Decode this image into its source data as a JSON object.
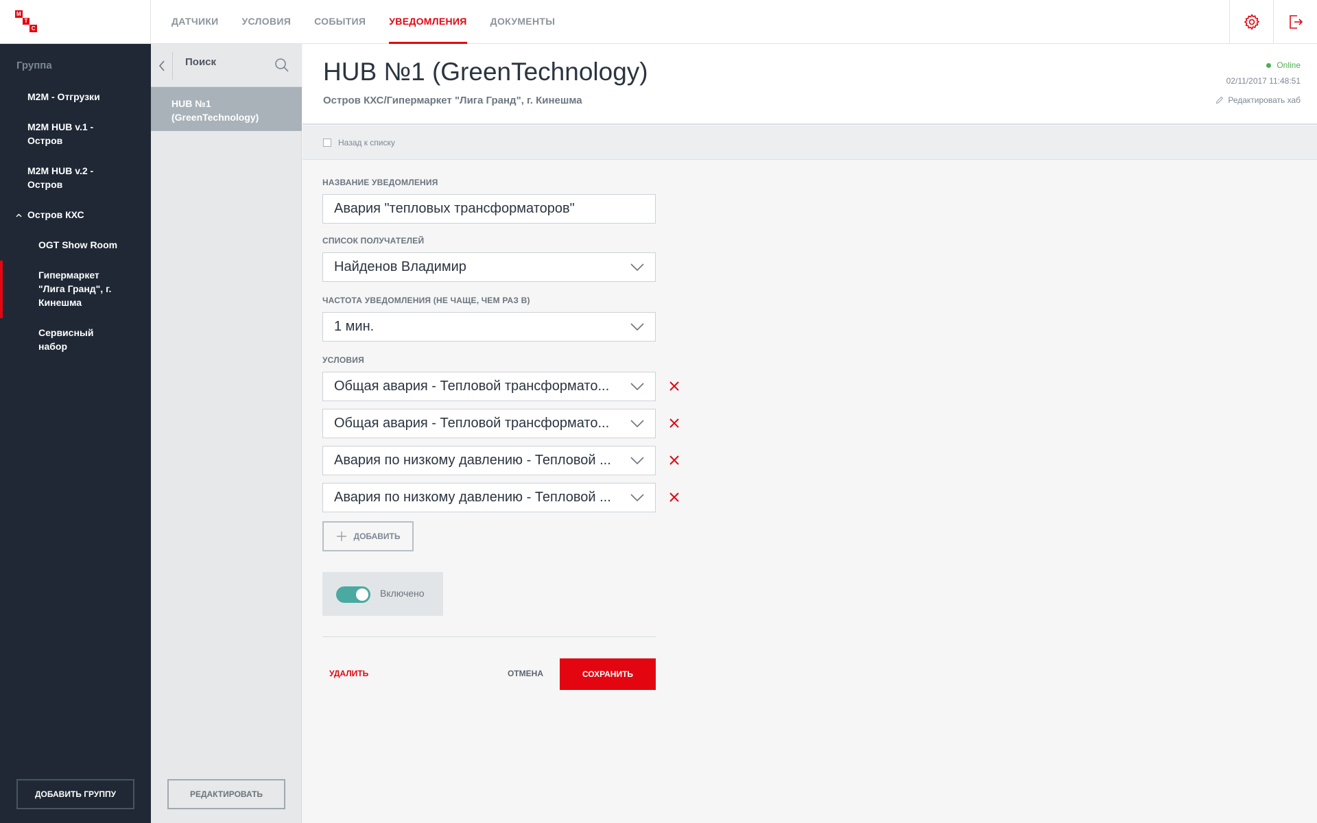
{
  "logo": {
    "letters": [
      "М",
      "Т",
      "С"
    ]
  },
  "nav": {
    "items": [
      "ДАТЧИКИ",
      "УСЛОВИЯ",
      "СОБЫТИЯ",
      "УВЕДОМЛЕНИЯ",
      "ДОКУМЕНТЫ"
    ],
    "active": "УВЕДОМЛЕНИЯ"
  },
  "sidebar": {
    "title": "Группа",
    "items": [
      "M2M - Отгрузки",
      "M2M HUB v.1 - Остров",
      "M2M HUB v.2 - Остров",
      "Остров КХС",
      "OGT Show Room",
      "Гипермаркет \"Лига Гранд\", г. Кинешма",
      "Сервисный набор"
    ],
    "active_item": "Гипермаркет \"Лига Гранд\", г. Кинешма",
    "add_group_label": "ДОБАВИТЬ ГРУППУ"
  },
  "hublist": {
    "search_placeholder": "Поиск",
    "items": [
      "HUB №1 (GreenTechnology)"
    ],
    "edit_label": "РЕДАКТИРОВАТЬ"
  },
  "header": {
    "title": "HUB №1 (GreenTechnology)",
    "subtitle": "Остров КХС/Гипермаркет \"Лига Гранд\", г. Кинешма",
    "status": "Online",
    "status_color": "#4caf50",
    "timestamp": "02/11/2017 11:48:51",
    "edit_hub_label": "Редактировать хаб"
  },
  "backbar": {
    "label": "Назад к списку"
  },
  "form": {
    "name_label": "НАЗВАНИЕ УВЕДОМЛЕНИЯ",
    "name_value": "Авария \"тепловых трансформаторов\"",
    "recipients_label": "СПИСОК ПОЛУЧАТЕЛЕЙ",
    "recipients_value": "Найденов Владимир",
    "frequency_label": "ЧАСТОТА УВЕДОМЛЕНИЯ (НЕ ЧАЩЕ, ЧЕМ РАЗ В)",
    "frequency_value": "1 мин.",
    "conditions_label": "УСЛОВИЯ",
    "conditions": [
      "Общая авария - Тепловой трансформато...",
      "Общая авария - Тепловой трансформато...",
      "Авария по низкому давлению - Тепловой ...",
      "Авария по низкому давлению - Тепловой ..."
    ],
    "add_label": "ДОБАВИТЬ",
    "enabled_label": "Включено",
    "enabled": true,
    "delete_label": "УДАЛИТЬ",
    "cancel_label": "ОТМЕНА",
    "save_label": "СОХРАНИТЬ"
  },
  "colors": {
    "accent": "#e30611",
    "sidebar_bg": "#1f2834",
    "toggle_on": "#4aa9a1"
  }
}
